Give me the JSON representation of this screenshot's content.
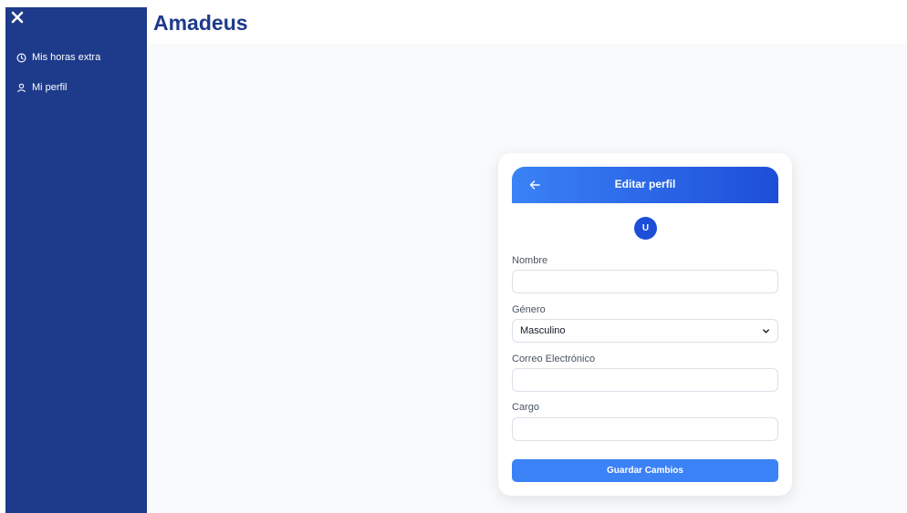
{
  "sidebar": {
    "close_icon": "close-icon",
    "items": [
      {
        "label": "Mis horas extra",
        "icon": "clock-icon"
      },
      {
        "label": "Mi perfil",
        "icon": "user-icon"
      }
    ]
  },
  "header": {
    "title": "Amadeus"
  },
  "card": {
    "title": "Editar perfil",
    "back_icon": "arrow-left-icon",
    "avatar_initial": "U",
    "fields": {
      "nombre": {
        "label": "Nombre",
        "value": ""
      },
      "genero": {
        "label": "Género",
        "value": "Masculino"
      },
      "correo": {
        "label": "Correo Electrónico",
        "value": ""
      },
      "cargo": {
        "label": "Cargo",
        "value": ""
      }
    },
    "save_label": "Guardar Cambios"
  },
  "colors": {
    "sidebar": "#1e3a8a",
    "accent": "#3b82f6",
    "accent_dark": "#1d4ed8",
    "content_bg": "#f8fafc"
  }
}
